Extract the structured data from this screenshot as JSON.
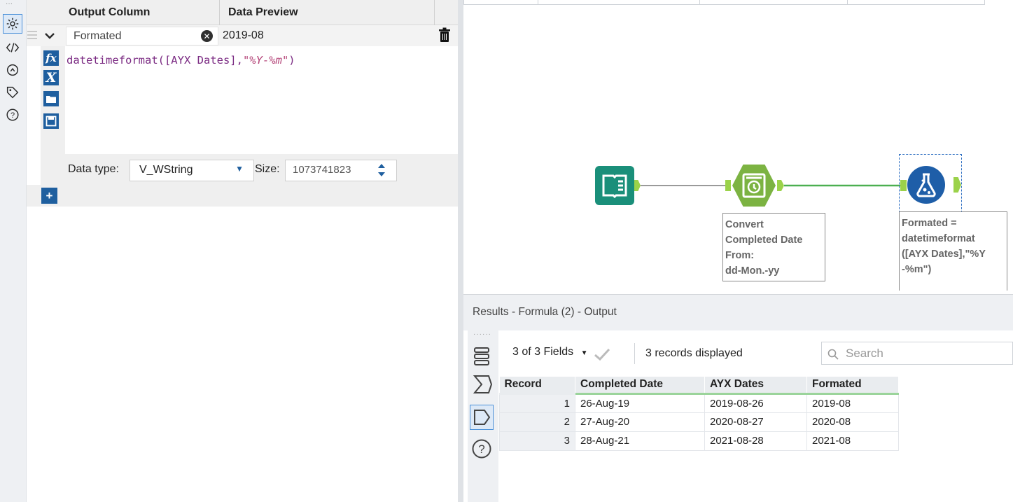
{
  "config": {
    "header": {
      "output_column": "Output Column",
      "data_preview": "Data Preview"
    },
    "expression": {
      "output_name": "Formated",
      "preview": "2019-08",
      "code_plain": "datetimeformat([AYX Dates],",
      "code_string": "\"%Y-%m\"",
      "code_close": ")"
    },
    "type_row": {
      "data_type_label": "Data type:",
      "data_type_value": "V_WString",
      "size_label": "Size:",
      "size_value": "1073741823"
    },
    "side_tools": [
      "fx",
      "X"
    ]
  },
  "canvas": {
    "notes": {
      "datetime": [
        "Convert",
        "Completed Date",
        "From:",
        "dd-Mon.-yy"
      ],
      "formula": [
        "Formated =",
        "datetimeformat",
        "([AYX Dates],\"%Y",
        "-%m\")"
      ]
    }
  },
  "results": {
    "title": "Results - Formula (2) - Output",
    "fields_label": "3 of 3 Fields",
    "records_label": "3 records displayed",
    "search_placeholder": "Search",
    "columns": [
      "Record",
      "Completed Date",
      "AYX Dates",
      "Formated"
    ],
    "rows": [
      [
        "1",
        "26-Aug-19",
        "2019-08-26",
        "2019-08"
      ],
      [
        "2",
        "27-Aug-20",
        "2020-08-27",
        "2020-08"
      ],
      [
        "3",
        "28-Aug-21",
        "2021-08-28",
        "2021-08"
      ]
    ]
  },
  "colors": {
    "accent": "#1f5f9f",
    "input_tool": "#1a8f7a",
    "datetime_tool": "#7cb342",
    "formula_tool": "#1e5ea8",
    "connection": "#4caf50"
  }
}
